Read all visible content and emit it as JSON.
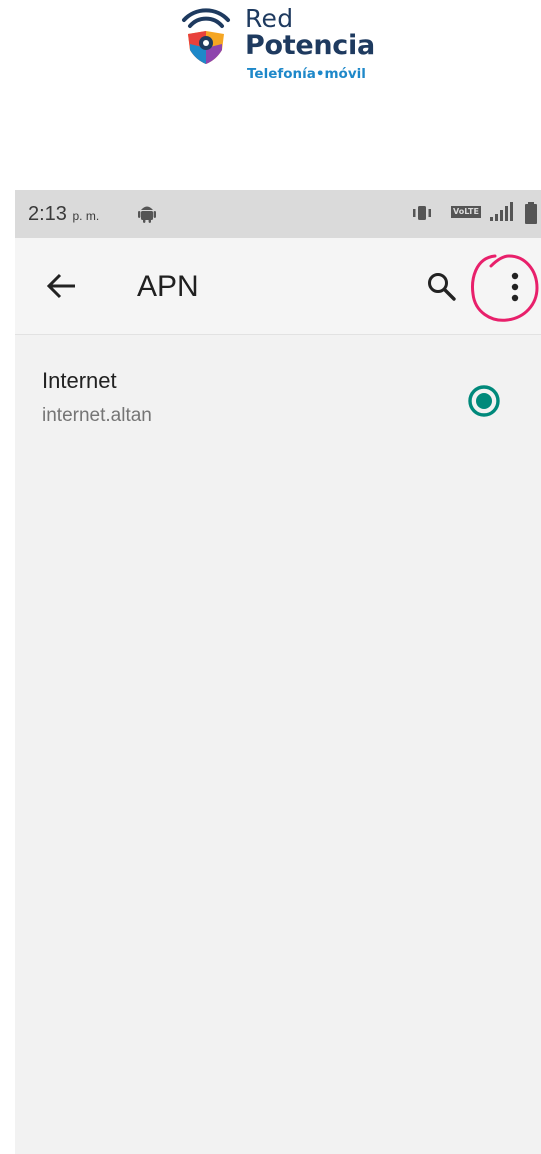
{
  "brand": {
    "line1": "Red",
    "line2": "Potencia",
    "line3": "Telefonía•móvil",
    "colors": {
      "navy": "#1e3a5f",
      "blue": "#1e88c9",
      "orange": "#f5a623",
      "red": "#e8413c",
      "purple": "#8e44ad"
    },
    "icon": "wifi-shield-logo"
  },
  "status_bar": {
    "time": "2:13",
    "ampm": "p. m.",
    "notification_icon": "android-icon",
    "volte_label": "VoLTE",
    "icons": [
      "vibrate-icon",
      "volte-icon",
      "signal-icon",
      "battery-icon"
    ]
  },
  "app_bar": {
    "title": "APN",
    "back_icon": "arrow-left-icon",
    "search_icon": "search-icon",
    "more_icon": "more-vert-icon",
    "highlight_color": "#e8206b"
  },
  "apn_list": [
    {
      "name": "Internet",
      "apn": "internet.altan",
      "selected": true,
      "accent": "#00897b"
    }
  ]
}
